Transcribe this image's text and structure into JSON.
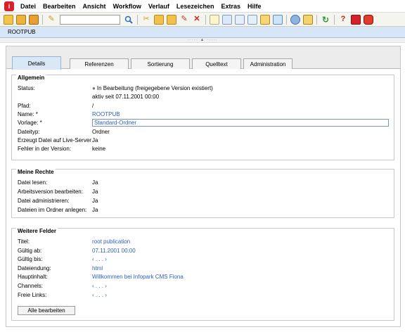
{
  "app_logo": "i",
  "menu": [
    "Datei",
    "Bearbeiten",
    "Ansicht",
    "Workflow",
    "Verlauf",
    "Lesezeichen",
    "Extras",
    "Hilfe"
  ],
  "toolbar": {
    "search_value": "",
    "icons": [
      "new-document-icon",
      "folder-new-icon",
      "folder-home-icon",
      "edit-pencil-icon",
      "search-icon",
      "cut-icon",
      "copy-icon",
      "paste-icon",
      "rename-icon",
      "delete-icon",
      "view-preview-icon",
      "view-details-icon",
      "view-list-icon",
      "view-tree-icon",
      "view-thumbnails-icon",
      "view-gallery-icon",
      "user-group-icon",
      "tasks-icon",
      "refresh-icon",
      "help-icon",
      "bookmark-icon",
      "logout-icon"
    ]
  },
  "title": "ROOTPUB",
  "splitter": "····· ▲ ·····",
  "tabs": [
    {
      "label": "Details",
      "active": true
    },
    {
      "label": "Referenzen",
      "active": false
    },
    {
      "label": "Sortierung",
      "active": false
    },
    {
      "label": "Quelltext",
      "active": false
    },
    {
      "label": "Administration",
      "active": false
    }
  ],
  "general": {
    "title": "Allgemein",
    "status_label": "Status:",
    "status_line1": "In Bearbeitung (freigegebene Version existiert)",
    "status_line2": "aktiv seit 07.11.2001 00:00",
    "path_label": "Pfad:",
    "path_value": "/",
    "name_label": "Name: *",
    "name_value": "ROOTPUB",
    "template_label": "Vorlage: *",
    "template_value": "Standard-Ordner",
    "filetype_label": "Dateityp:",
    "filetype_value": "Ordner",
    "live_label": "Erzeugt Datei auf Live-Server",
    "live_value": "Ja",
    "errors_label": "Fehler in der Version:",
    "errors_value": "keine"
  },
  "rights": {
    "title": "Meine Rechte",
    "rows": [
      {
        "label": "Datei lesen:",
        "value": "Ja"
      },
      {
        "label": "Arbeitsversion bearbeiten:",
        "value": "Ja"
      },
      {
        "label": "Datei administrieren:",
        "value": "Ja"
      },
      {
        "label": "Dateien im Ordner anlegen:",
        "value": "Ja"
      }
    ]
  },
  "fields": {
    "title": "Weitere Felder",
    "rows": [
      {
        "label": "Titel:",
        "value": "root publication"
      },
      {
        "label": "Gültig ab:",
        "value": "07.11.2001 00:00"
      },
      {
        "label": "Gültig bis:",
        "value": "‹ . . . ›"
      },
      {
        "label": "Dateiendung:",
        "value": "html"
      },
      {
        "label": "Hauptinhalt:",
        "value": "Willkommen bei Infopark CMS Fiona"
      },
      {
        "label": "Channels:",
        "value": "‹ . . . ›"
      },
      {
        "label": "Freie Links:",
        "value": "‹ . . . ›"
      }
    ],
    "edit_button": "Alle bearbeiten"
  }
}
